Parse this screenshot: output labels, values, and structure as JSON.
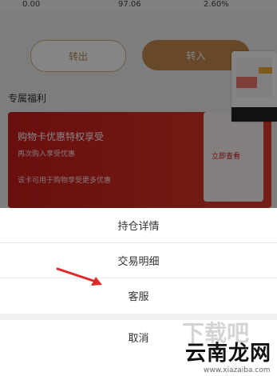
{
  "background": {
    "stats": [
      "0.00",
      "97.06",
      "",
      "2.60%"
    ],
    "button_outline": "转出",
    "button_filled": "转入",
    "section_title": "专属福利",
    "banner_line1": "购物卡优惠特权享受",
    "banner_line2": "再次购入享受优惠",
    "banner_line3": "该卡可用于购物享受更多优惠",
    "banner_side_link": "立即查看"
  },
  "action_sheet": {
    "items": [
      "持仓详情",
      "交易明细",
      "客服"
    ],
    "cancel": "取消"
  },
  "watermark": {
    "brand": "云南龙网",
    "url": "www.xiazaiba.com"
  },
  "colors": {
    "accent": "#c58a4d",
    "banner": "#c91d1d",
    "arrow": "#e02a2a"
  }
}
